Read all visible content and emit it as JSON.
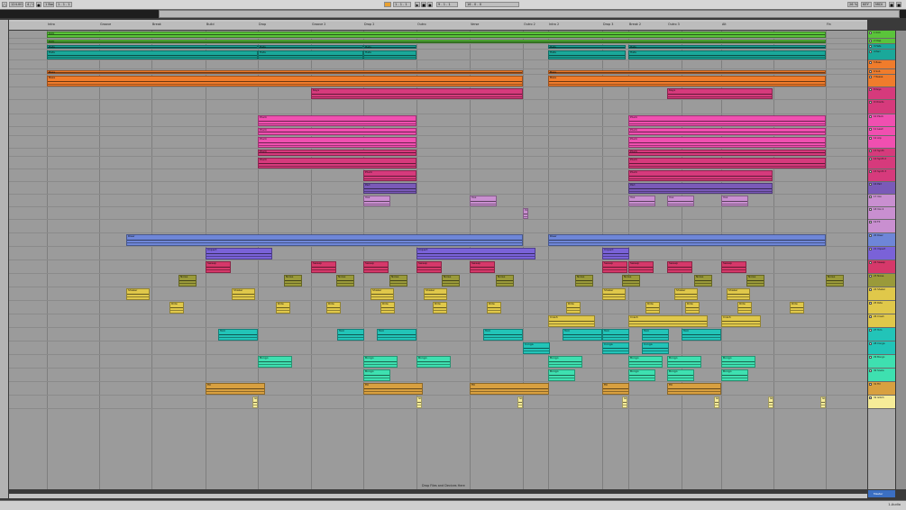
{
  "control_bar": {
    "tempo": "124.00",
    "time_sig": "4 / 4",
    "metronome": "1 Bar",
    "position": "1 . 1 . 1",
    "loop_start": "9 . 1 . 1",
    "loop_length": "16 . 0 . 0",
    "cpu": "26 %",
    "key_label": "KEY",
    "midi_label": "MIDI"
  },
  "locators": [
    "Intro",
    "Groove",
    "Break",
    "Build",
    "Drop",
    "Groove 2",
    "Drop 2",
    "Outro",
    "Verse",
    "Outro 2",
    "Intro 2",
    "Drop 3",
    "Break 2",
    "Outro 3",
    "Alt",
    "Fin"
  ],
  "drop_hint": "Drop Files and Devices Here",
  "tracks": [
    {
      "name": "1 Kick",
      "color": "#5ac43a"
    },
    {
      "name": "2 Clap",
      "color": "#5ac43a"
    },
    {
      "name": "3 Hats",
      "color": "#1aa89a"
    },
    {
      "name": "4 Perc",
      "color": "#1aa89a"
    },
    {
      "name": "5 Bass",
      "color": "#f07c2c"
    },
    {
      "name": "6 Sub",
      "color": "#f07c2c"
    },
    {
      "name": "7 Reese",
      "color": "#f07c2c"
    },
    {
      "name": "8 Keys",
      "color": "#d63a7c"
    },
    {
      "name": "9 Chords",
      "color": "#d63a7c"
    },
    {
      "name": "10 Pluck",
      "color": "#f04fb0"
    },
    {
      "name": "11 Lead",
      "color": "#f04fb0"
    },
    {
      "name": "12 Arp",
      "color": "#f04fb0"
    },
    {
      "name": "13 Synth",
      "color": "#d63a7c"
    },
    {
      "name": "14 Synth 2",
      "color": "#d63a7c"
    },
    {
      "name": "15 Synth 3",
      "color": "#d63a7c"
    },
    {
      "name": "16 Pad",
      "color": "#7a5ab8"
    },
    {
      "name": "17 Vox",
      "color": "#c98fd0"
    },
    {
      "name": "18 Vox 2",
      "color": "#c98fd0"
    },
    {
      "name": "19 FX",
      "color": "#c98fd0"
    },
    {
      "name": "20 Riser",
      "color": "#6e86d8"
    },
    {
      "name": "21 Impact",
      "color": "#7a62d8"
    },
    {
      "name": "22 Sweep",
      "color": "#d6386a"
    },
    {
      "name": "23 Noise",
      "color": "#9a9a3a"
    },
    {
      "name": "24 Shaker",
      "color": "#e0c84a"
    },
    {
      "name": "25 Ride",
      "color": "#e0c84a"
    },
    {
      "name": "26 Crash",
      "color": "#e0c84a"
    },
    {
      "name": "27 Tom",
      "color": "#22c4b8"
    },
    {
      "name": "28 Conga",
      "color": "#22c4b8"
    },
    {
      "name": "29 Bongo",
      "color": "#3ee0b0"
    },
    {
      "name": "30 Snare",
      "color": "#3ee0b0"
    },
    {
      "name": "31 Fill",
      "color": "#d8a040"
    },
    {
      "name": "32 Glitch",
      "color": "#f6ec98"
    }
  ],
  "master_label": "Master",
  "clip_labels": {
    "kick": "Kick",
    "hats": "Hats",
    "bass": "Bass",
    "keys": "Keys",
    "pluck": "Pluck",
    "pad": "Pad",
    "vox": "Vox",
    "riser": "Riser",
    "impact": "Impact",
    "sweep": "Sweep",
    "noise": "Noise",
    "shaker": "Shaker",
    "ride": "Ride",
    "crash": "Crash",
    "tom": "Tom",
    "conga": "Conga",
    "bongo": "Bongo",
    "fill": "Fill",
    "glitch": "Glitch"
  },
  "status": {
    "left": "",
    "right": "1-Audio"
  }
}
